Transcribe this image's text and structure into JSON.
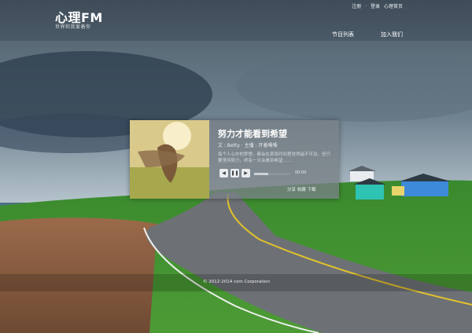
{
  "site": {
    "logo": "心理FM",
    "slogan": "世界和我爱着你"
  },
  "top_links": {
    "register": "注册",
    "sep": "·",
    "login": "登录",
    "home": "心理首页"
  },
  "nav": [
    {
      "label": "节目列表"
    },
    {
      "label": "加入我们"
    }
  ],
  "player": {
    "title": "努力才能看到希望",
    "meta": "文 : Betty · 主播 : 开着嗓嗓",
    "description": "每个人心中的梦想，都会在某段时间里觉得遥不可及。但只要坚持努力，终有一天会看到希望……",
    "time": "00:00",
    "progress": 0.4,
    "actions": {
      "share": "分享",
      "collect": "收藏",
      "download": "下载"
    }
  },
  "footer": {
    "copyright": "© 2012-2014 com Corporation"
  }
}
